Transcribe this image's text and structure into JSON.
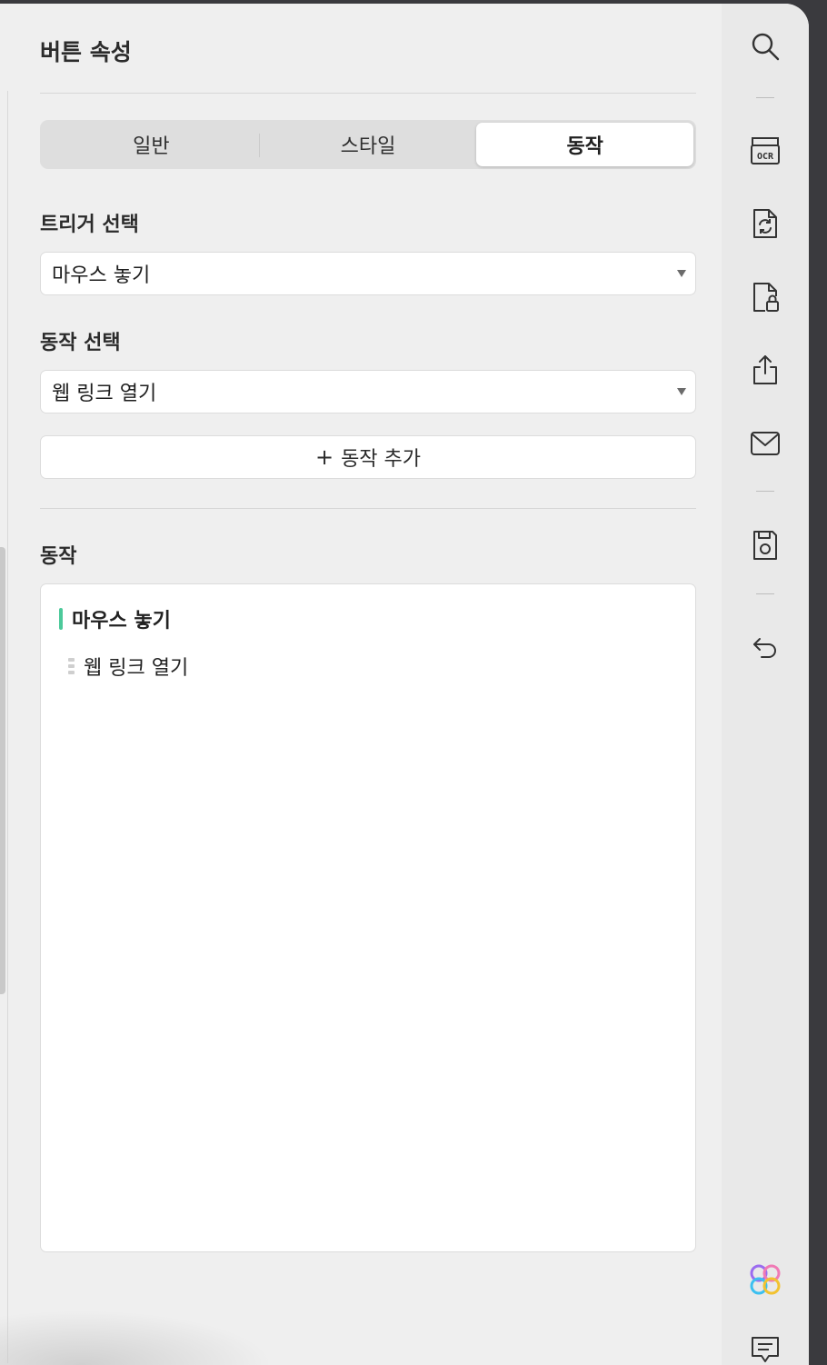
{
  "panel": {
    "title": "버튼 속성",
    "tabs": [
      {
        "label": "일반",
        "active": false
      },
      {
        "label": "스타일",
        "active": false
      },
      {
        "label": "동작",
        "active": true
      }
    ],
    "trigger": {
      "label": "트리거 선택",
      "value": "마우스 놓기"
    },
    "action": {
      "label": "동작 선택",
      "value": "웹 링크 열기"
    },
    "add_action_label": "동작 추가",
    "actions_section": {
      "label": "동작",
      "trigger_item": "마우스 놓기",
      "action_item": "웹 링크 열기"
    }
  },
  "toolbar": {
    "icons": [
      "search-icon",
      "ocr-icon",
      "convert-document-icon",
      "protect-document-icon",
      "share-icon",
      "mail-icon",
      "save-icon",
      "undo-icon",
      "ai-assistant-icon",
      "comment-icon"
    ]
  },
  "colors": {
    "accent_green": "#4cc99a",
    "panel_bg": "#efefef",
    "toolbar_bg": "#e9e9e9"
  }
}
